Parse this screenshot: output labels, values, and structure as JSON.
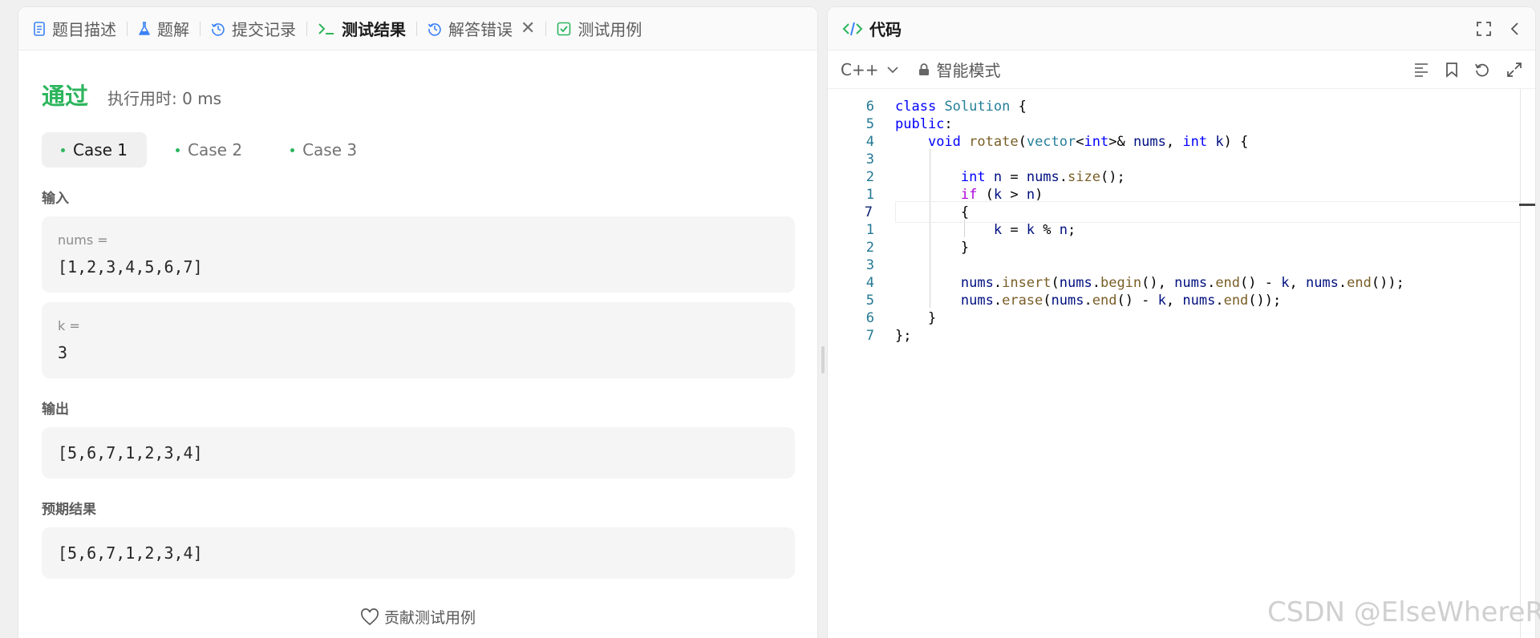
{
  "left": {
    "tabs": [
      {
        "label": "题目描述",
        "icon": "document-icon",
        "active": false
      },
      {
        "label": "题解",
        "icon": "flask-icon",
        "active": false
      },
      {
        "label": "提交记录",
        "icon": "history-icon",
        "active": false
      },
      {
        "label": "测试结果",
        "icon": "terminal-icon",
        "active": true
      },
      {
        "label": "解答错误",
        "icon": "history-icon",
        "active": false,
        "closable": true
      },
      {
        "label": "测试用例",
        "icon": "checkbox-icon",
        "active": false
      }
    ],
    "status": "通过",
    "runtime": "执行用时: 0 ms",
    "cases": [
      "Case 1",
      "Case 2",
      "Case 3"
    ],
    "active_case": 0,
    "input_label": "输入",
    "inputs": [
      {
        "name": "nums =",
        "value": "[1,2,3,4,5,6,7]"
      },
      {
        "name": "k =",
        "value": "3"
      }
    ],
    "output_label": "输出",
    "output_value": "[5,6,7,1,2,3,4]",
    "expected_label": "预期结果",
    "expected_value": "[5,6,7,1,2,3,4]",
    "contribute_label": "贡献测试用例"
  },
  "right": {
    "title": "代码",
    "language": "C++",
    "mode": "智能模式",
    "code_lines": [
      {
        "n": "6",
        "text": "class Solution {"
      },
      {
        "n": "5",
        "text": "public:"
      },
      {
        "n": "4",
        "text": "    void rotate(vector<int>& nums, int k) {"
      },
      {
        "n": "3",
        "text": ""
      },
      {
        "n": "2",
        "text": "        int n = nums.size();"
      },
      {
        "n": "1",
        "text": "        if (k > n)"
      },
      {
        "n": "7",
        "text": "        {",
        "current": true
      },
      {
        "n": "1",
        "text": "            k = k % n;"
      },
      {
        "n": "2",
        "text": "        }"
      },
      {
        "n": "3",
        "text": ""
      },
      {
        "n": "4",
        "text": "        nums.insert(nums.begin(), nums.end() - k, nums.end());"
      },
      {
        "n": "5",
        "text": "        nums.erase(nums.end() - k, nums.end());"
      },
      {
        "n": "6",
        "text": "    }"
      },
      {
        "n": "7",
        "text": "};"
      }
    ]
  },
  "watermark": "CSDN @ElseWhereR",
  "colors": {
    "pass": "#2db55d",
    "accent_green": "#2db55d",
    "line_number": "#237893"
  }
}
